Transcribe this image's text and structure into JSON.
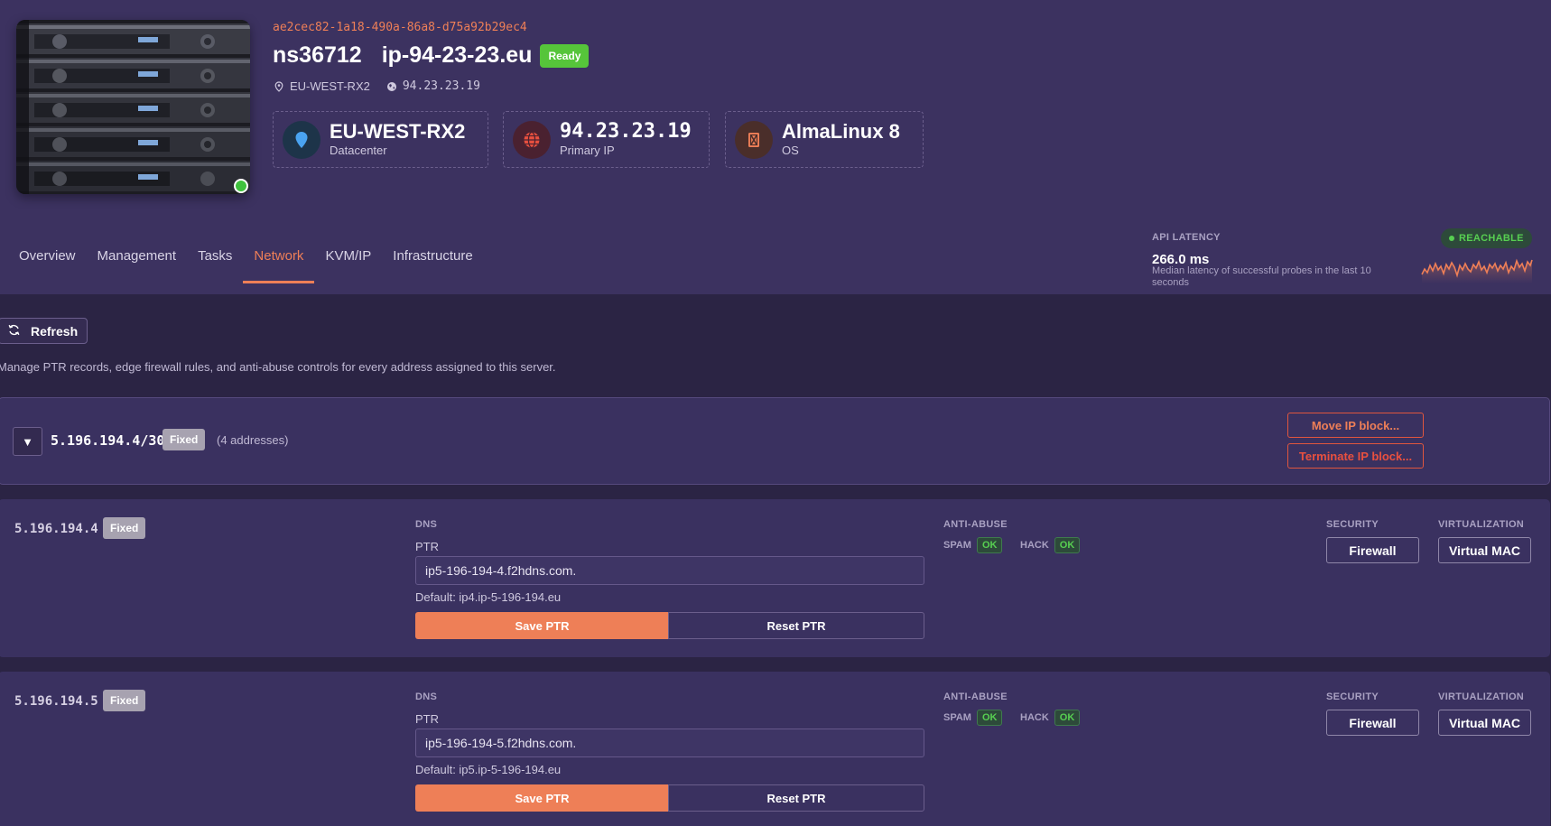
{
  "server": {
    "uuid": "ae2cec82-1a18-490a-86a8-d75a92b29ec4",
    "name": "ns36712",
    "hostname": "ip-94-23-23.eu",
    "status": "Ready",
    "location": "EU-WEST-RX2",
    "ip": "94.23.23.19"
  },
  "cards": {
    "datacenter": {
      "value": "EU-WEST-RX2",
      "label": "Datacenter",
      "icon": "map-pin-icon"
    },
    "primary_ip": {
      "value": "94.23.23.19",
      "label": "Primary IP",
      "icon": "globe-icon"
    },
    "os": {
      "value": "AlmaLinux 8",
      "label": "OS",
      "icon": "os-icon"
    }
  },
  "tabs": [
    {
      "label": "Overview",
      "active": false
    },
    {
      "label": "Management",
      "active": false
    },
    {
      "label": "Tasks",
      "active": false
    },
    {
      "label": "Network",
      "active": true
    },
    {
      "label": "KVM/IP",
      "active": false
    },
    {
      "label": "Infrastructure",
      "active": false
    }
  ],
  "latency": {
    "title": "API LATENCY",
    "value": "266.0 ms",
    "description": "Median latency of successful probes in the last 10 seconds",
    "status": "REACHABLE",
    "status_color": "#57cf51"
  },
  "toolbar": {
    "refresh_label": "Refresh"
  },
  "page_description": "Manage PTR records, edge firewall rules, and anti-abuse controls for every address assigned to this server.",
  "ip_block": {
    "cidr": "5.196.194.4/30",
    "type": "Fixed",
    "count": "(4 addresses)",
    "collapse_symbol": "▼",
    "move_label": "Move IP block...",
    "terminate_label": "Terminate IP block..."
  },
  "section_labels": {
    "dns": "DNS",
    "ptr": "PTR",
    "anti_abuse": "ANTI-ABUSE",
    "spam": "SPAM",
    "hack": "HACK",
    "security": "SECURITY",
    "virtualization": "VIRTUALIZATION"
  },
  "ips": [
    {
      "address": "5.196.194.4",
      "type": "Fixed",
      "ptr_value": "ip5-196-194-4.f2hdns.com.",
      "ptr_default": "Default: ip4.ip-5-196-194.eu",
      "spam_status": "OK",
      "hack_status": "OK",
      "save_label": "Save PTR",
      "reset_label": "Reset PTR",
      "firewall_label": "Firewall",
      "vmac_label": "Virtual MAC"
    },
    {
      "address": "5.196.194.5",
      "type": "Fixed",
      "ptr_value": "ip5-196-194-5.f2hdns.com.",
      "ptr_default": "Default: ip5.ip-5-196-194.eu",
      "spam_status": "OK",
      "hack_status": "OK",
      "save_label": "Save PTR",
      "reset_label": "Reset PTR",
      "firewall_label": "Firewall",
      "vmac_label": "Virtual MAC"
    }
  ],
  "colors": {
    "accent": "#ee7f57",
    "ready": "#56c53a",
    "ok": "#57cf51",
    "danger": "#e8503f",
    "background": "#2b2444",
    "header": "#3c3260"
  }
}
